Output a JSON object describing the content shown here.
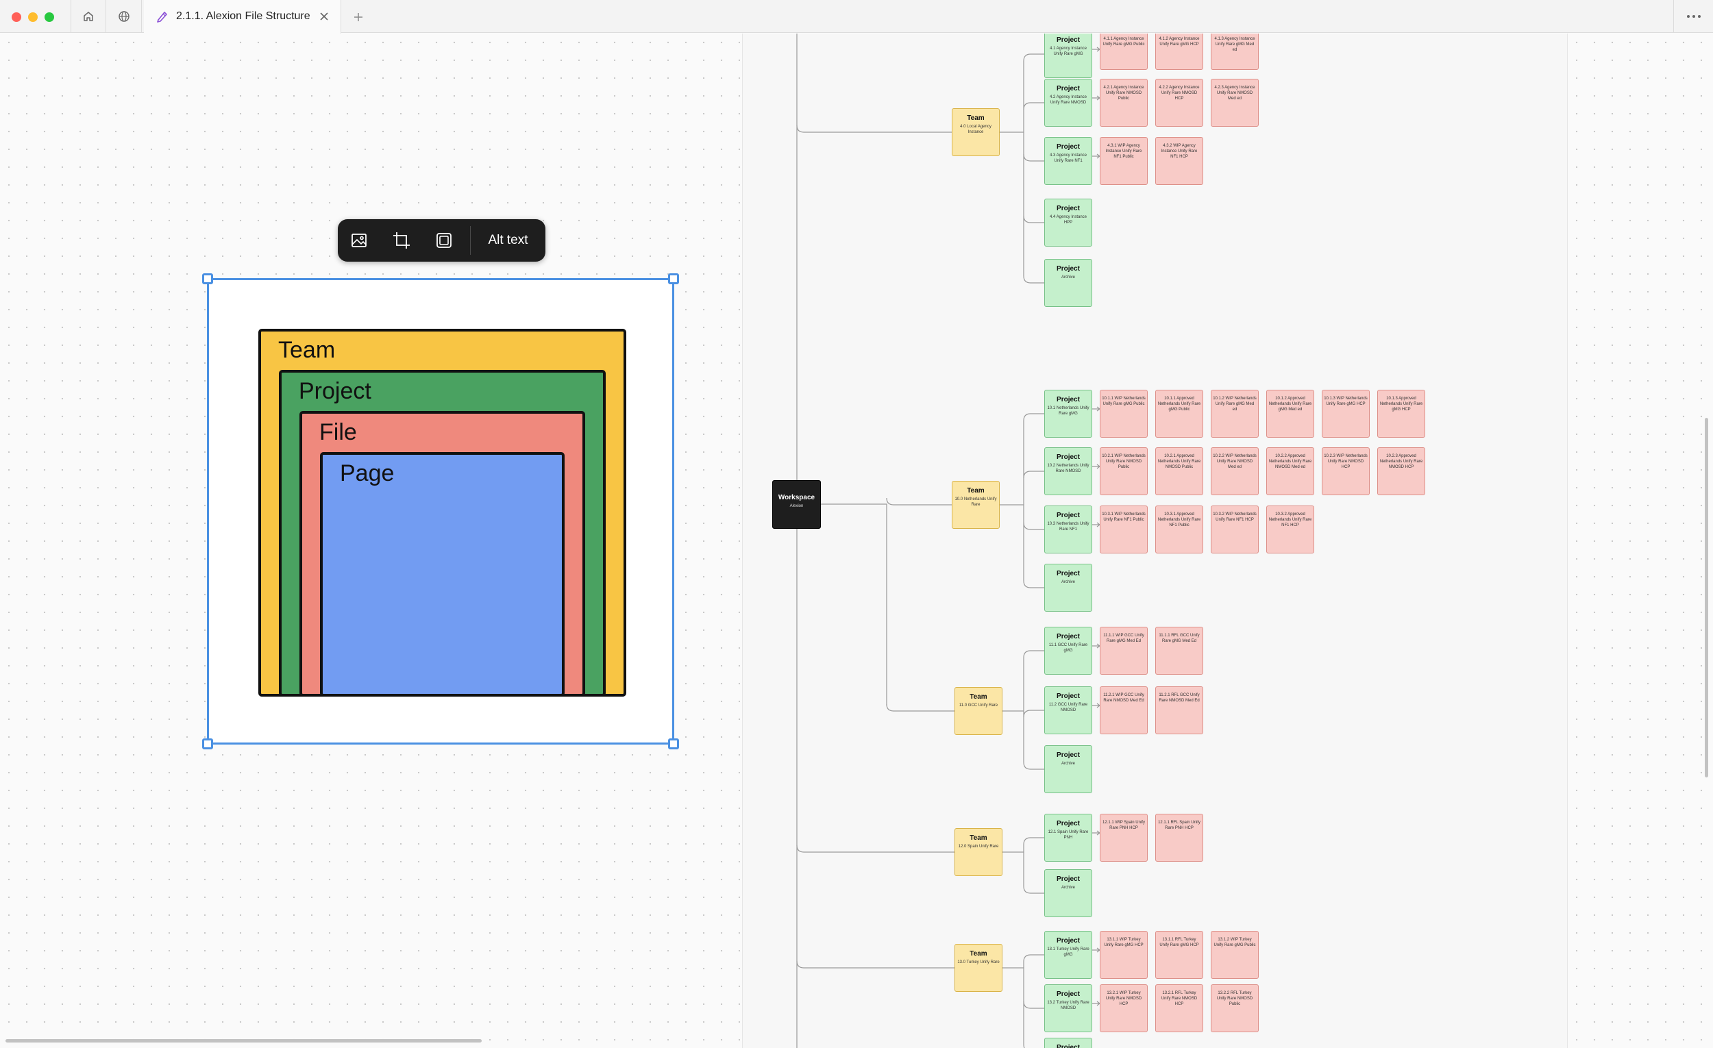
{
  "window": {
    "tab_title": "2.1.1. Alexion File Structure",
    "icons": [
      "home-icon",
      "globe-icon",
      "figjam-file-icon",
      "close-icon",
      "plus-icon",
      "more-icon"
    ]
  },
  "image_toolbar": {
    "icons": [
      "replace-image-icon",
      "crop-icon",
      "mask-icon"
    ],
    "alt_text_label": "Alt text"
  },
  "nesting_image": {
    "layers": [
      "Team",
      "Project",
      "File",
      "Page"
    ],
    "colors": {
      "team": "#f8c544",
      "project": "#4aa261",
      "file": "#ef897d",
      "page": "#729cf2"
    }
  },
  "tree": {
    "workspace": {
      "title": "Workspace",
      "sub": "Alexion"
    },
    "teams": [
      {
        "title": "Team",
        "sub": "4.0 Local Agency Instance"
      },
      {
        "title": "Team",
        "sub": "10.0 Netherlands Unify Rare"
      },
      {
        "title": "Team",
        "sub": "11.0 GCC Unify Rare"
      },
      {
        "title": "Team",
        "sub": "12.0 Spain Unify Rare"
      },
      {
        "title": "Team",
        "sub": "13.0 Turkey Unify Rare"
      }
    ],
    "projects": [
      {
        "title": "Project",
        "sub": "4.1 Agency Instance Unify Rare gMG"
      },
      {
        "title": "Project",
        "sub": "4.2 Agency Instance Unify Rare NMOSD"
      },
      {
        "title": "Project",
        "sub": "4.3 Agency Instance Unify Rare NF1"
      },
      {
        "title": "Project",
        "sub": "4.4 Agency Instance HPP"
      },
      {
        "title": "Project",
        "sub": "Archive"
      },
      {
        "title": "Project",
        "sub": "10.1 Netherlands Unify Rare gMG"
      },
      {
        "title": "Project",
        "sub": "10.2 Netherlands Unify Rare NMOSD"
      },
      {
        "title": "Project",
        "sub": "10.3 Netherlands Unify Rare NF1"
      },
      {
        "title": "Project",
        "sub": "Archive"
      },
      {
        "title": "Project",
        "sub": "11.1 GCC Unify Rare gMG"
      },
      {
        "title": "Project",
        "sub": "11.2 GCC Unify Rare NMOSD"
      },
      {
        "title": "Project",
        "sub": "Archive"
      },
      {
        "title": "Project",
        "sub": "12.1 Spain Unify Rare PNH"
      },
      {
        "title": "Project",
        "sub": "Archive"
      },
      {
        "title": "Project",
        "sub": "13.1 Turkey Unify Rare gMG"
      },
      {
        "title": "Project",
        "sub": "13.2 Turkey Unify Rare NMOSD"
      },
      {
        "title": "Project",
        "sub": ""
      }
    ],
    "files": [
      "4.1.1 Agency Instance Unify Rare gMG Public",
      "4.1.2 Agency Instance Unify Rare gMG HCP",
      "4.1.3 Agency Instance Unify Rare gMG Med ed",
      "4.2.1 Agency Instance Unify Rare NMOSD Public",
      "4.2.2 Agency Instance Unify Rare NMOSD HCP",
      "4.2.3 Agency Instance Unify Rare NMOSD Med ed",
      "4.3.1 WIP Agency Instance Unify Rare NF1 Public",
      "4.3.2 WIP Agency Instance Unify Rare NF1 HCP",
      "10.1.1 WIP Netherlands Unify Rare gMG Public",
      "10.1.1 Approved Netherlands Unify Rare gMG Public",
      "10.1.2 WIP Netherlands Unify Rare gMG Med ed",
      "10.1.2 Approved Netherlands Unify Rare gMG Med ed",
      "10.1.3 WIP Netherlands Unify Rare gMG HCP",
      "10.1.3 Approved Netherlands Unify Rare gMG HCP",
      "10.2.1 WIP Netherlands Unify Rare NMOSD Public",
      "10.2.1 Approved Netherlands Unify Rare NMOSD Public",
      "10.2.2 WIP Netherlands Unify Rare NMOSD Med ed",
      "10.2.2 Approved Netherlands Unify Rare NMOSD Med ed",
      "10.2.3 WIP Netherlands Unify Rare NMOSD HCP",
      "10.2.3 Approved Netherlands Unify Rare NMOSD HCP",
      "10.3.1 WIP Netherlands Unify Rare NF1 Public",
      "10.3.1 Approved Netherlands Unify Rare NF1 Public",
      "10.3.2 WIP Netherlands Unify Rare NF1 HCP",
      "10.3.2 Approved Netherlands Unify Rare NF1 HCP",
      "11.1.1 WIP GCC Unify Rare gMG Med Ed",
      "11.1.1 RFL GCC Unify Rare gMG Med Ed",
      "11.2.1 WIP GCC Unify Rare NMOSD Med Ed",
      "11.2.1 RFL GCC Unify Rare NMOSD Med Ed",
      "12.1.1 WIP Spain Unify Rare PNH HCP",
      "12.1.1 RFL Spain Unify Rare PNH HCP",
      "13.1.1 WIP Turkey Unify Rare gMG HCP",
      "13.1.1 RFL Turkey Unify Rare gMG HCP",
      "13.1.2 WIP Turkey Unify Rare gMG Public",
      "13.2.1 WIP Turkey Unify Rare NMOSD HCP",
      "13.2.1 RFL Turkey Unify Rare NMOSD HCP",
      "13.2.2 RFL Turkey Unify Rare NMOSD Public"
    ]
  }
}
